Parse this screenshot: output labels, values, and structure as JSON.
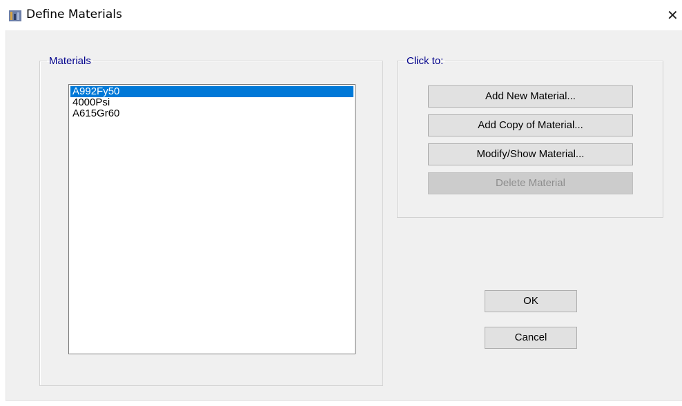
{
  "window": {
    "title": "Define Materials",
    "close_glyph": "✕",
    "icon": "etabs-app-icon"
  },
  "materials_group": {
    "legend": "Materials",
    "items": [
      {
        "label": "A992Fy50",
        "selected": true
      },
      {
        "label": "4000Psi",
        "selected": false
      },
      {
        "label": "A615Gr60",
        "selected": false
      }
    ]
  },
  "click_to_group": {
    "legend": "Click to:",
    "add_new_label": "Add New Material...",
    "add_copy_label": "Add Copy of Material...",
    "modify_label": "Modify/Show Material...",
    "delete_label": "Delete Material",
    "delete_enabled": false
  },
  "buttons": {
    "ok_label": "OK",
    "cancel_label": "Cancel"
  },
  "colors": {
    "legend_text": "#00008b",
    "selection": "#0078d7",
    "dialog_bg": "#f0f0f0"
  }
}
